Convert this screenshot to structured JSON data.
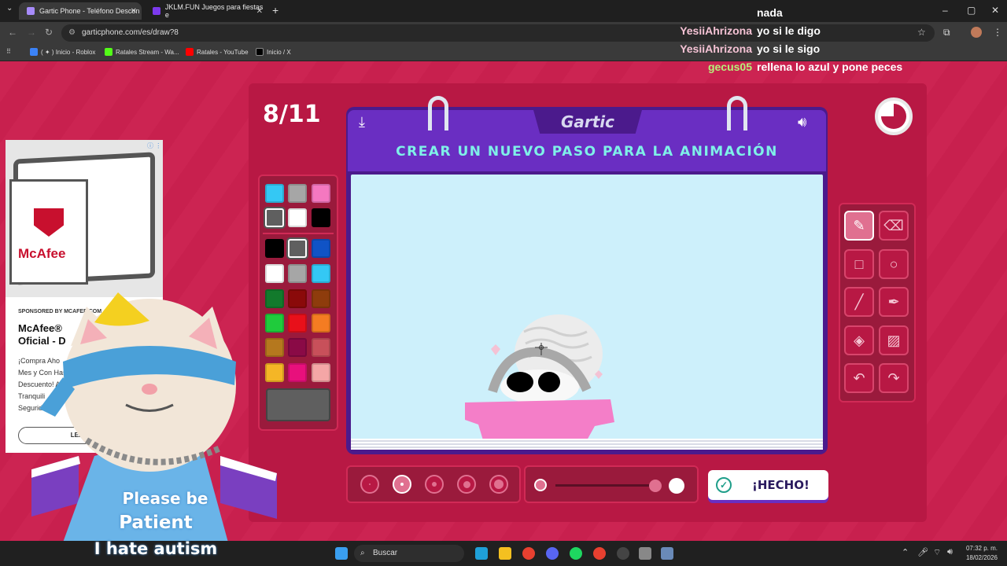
{
  "browser": {
    "tabs": [
      {
        "title": "Gartic Phone - Teléfono Descon",
        "active": true,
        "icon_color": "#a78bfa"
      },
      {
        "title": "JKLM.FUN Juegos para fiestas e",
        "active": false,
        "icon_color": "#7c3aed"
      }
    ],
    "url": "garticphone.com/es/draw?8",
    "bookmarks": [
      {
        "label": "( ✦ ) Inicio - Roblox",
        "icon_color": "#3b82f6"
      },
      {
        "label": "Ratales Stream - Wa...",
        "icon_color": "#53fc18"
      },
      {
        "label": "Ratales - YouTube",
        "icon_color": "#ff0000"
      },
      {
        "label": "Inicio / X",
        "icon_color": "#000000"
      }
    ]
  },
  "chat": {
    "top_fragment": "nada",
    "messages": [
      {
        "user": "YesiiAhrizona",
        "text": "yo si le digo",
        "color": "#f4c2d4"
      },
      {
        "user": "YesiiAhrizona",
        "text": "yo si le sigo",
        "color": "#f4c2d4"
      },
      {
        "user": "gecus05",
        "text": "rellena lo azul y pone peces",
        "color": "#b6f07a"
      }
    ]
  },
  "game": {
    "round": "8/11",
    "logo": "Gartic",
    "instruction": "CREAR UN NUEVO PASO PARA LA ANIMACIÓN",
    "done_label": "¡HECHO!",
    "palette": [
      "#34c8f4",
      "#a6a6a6",
      "#f478c0",
      "#5f5f5f",
      "#ffffff",
      "#000000",
      "#000000",
      "#5f5f5f",
      "#1053c6",
      "#ffffff",
      "#a6a6a6",
      "#34c8f4",
      "#127a2c",
      "#8a0a0a",
      "#8e3c0c",
      "#1fcb3c",
      "#e8101a",
      "#f47c22",
      "#b5781e",
      "#8a0a46",
      "#c8505a",
      "#f4b626",
      "#e8107c",
      "#f4a6a6"
    ],
    "selected_swatches": [
      3,
      7
    ],
    "current_color": "#5f5f5f",
    "tools": [
      "pencil-icon",
      "eraser-icon",
      "rectangle-icon",
      "ellipse-icon",
      "line-icon",
      "eyedropper-icon",
      "fill-icon",
      "clear-icon",
      "undo-icon",
      "redo-icon"
    ],
    "selected_tool": 0,
    "brush_sizes": [
      1,
      2,
      3,
      4,
      5
    ],
    "selected_size": 1
  },
  "ad": {
    "sponsor": "SPONSORED BY MCAFEE.COM",
    "brand": "McAfee",
    "title": "McAfee®\nOficial - D",
    "body": "¡Compra Aho\nMes y Con Has\nDescuento! As\nTranquili\nSeguridad y",
    "button": "LEARN M",
    "info": "ⓘ ⋮"
  },
  "overlay": {
    "line1": "Please be",
    "line2": "Patient",
    "line3": "I hate autism"
  },
  "taskbar": {
    "search": "Buscar",
    "time": "07:32 p. m.",
    "date": "18/02/2026"
  }
}
